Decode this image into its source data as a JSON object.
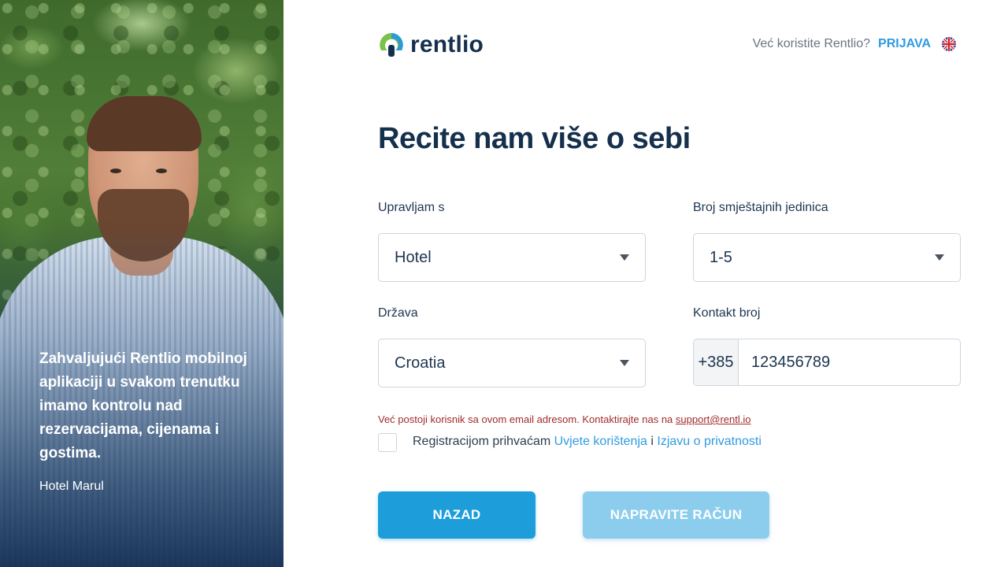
{
  "left_panel": {
    "quote": "Zahvaljujući Rentlio mobilnoj aplikaciji u svakom trenutku imamo kontrolu nad rezervacijama, cijenama i gostima.",
    "author": "Hotel Marul"
  },
  "header": {
    "brand": "rentlio",
    "login_question": "Već koristite Rentlio?",
    "login_link": "PRIJAVA",
    "language_icon": "uk-flag-icon"
  },
  "form": {
    "title": "Recite nam više o sebi",
    "manage_label": "Upravljam s",
    "manage_value": "Hotel",
    "units_label": "Broj smještajnih jedinica",
    "units_value": "1-5",
    "country_label": "Država",
    "country_value": "Croatia",
    "phone_label": "Kontakt broj",
    "phone_prefix": "+385",
    "phone_value": "123456789",
    "error_text": "Već postoji korisnik sa ovom email adresom. Kontaktirajte nas na",
    "error_email": "support@rentl.io",
    "terms_prefix": "Registracijom prihvaćam",
    "terms_link": "Uvjete korištenja",
    "terms_and": "i",
    "privacy_link": "Izjavu o privatnosti",
    "terms_checked": false
  },
  "buttons": {
    "back": "NAZAD",
    "create": "NAPRAVITE RAČUN"
  },
  "colors": {
    "brand_dark": "#15304c",
    "accent": "#1e9ddb",
    "accent_disabled": "#8ccdee",
    "error": "#a32a2a"
  }
}
